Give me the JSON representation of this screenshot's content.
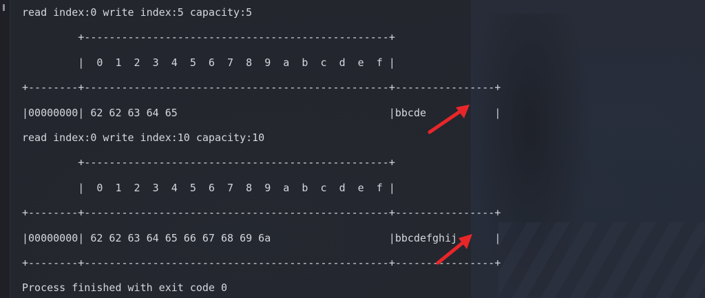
{
  "console": {
    "lines": [
      "read index:0 write index:5 capacity:5",
      "         +-------------------------------------------------+",
      "         |  0  1  2  3  4  5  6  7  8  9  a  b  c  d  e  f |",
      "+--------+-------------------------------------------------+----------------+",
      "|00000000| 62 62 63 64 65                                  |bbcde           |",
      "read index:0 write index:10 capacity:10",
      "         +-------------------------------------------------+",
      "         |  0  1  2  3  4  5  6  7  8  9  a  b  c  d  e  f |",
      "+--------+-------------------------------------------------+----------------+",
      "|00000000| 62 62 63 64 65 66 67 68 69 6a                   |bbcdefghij      |",
      "+--------+-------------------------------------------------+----------------+",
      "Process finished with exit code 0"
    ]
  },
  "colors": {
    "background": "#23262d",
    "text": "#d5d8de",
    "annotation_arrow": "#e8262a"
  },
  "icons": {
    "gutter": "fold-marker-icon",
    "annotation": "red-arrow-icon"
  }
}
